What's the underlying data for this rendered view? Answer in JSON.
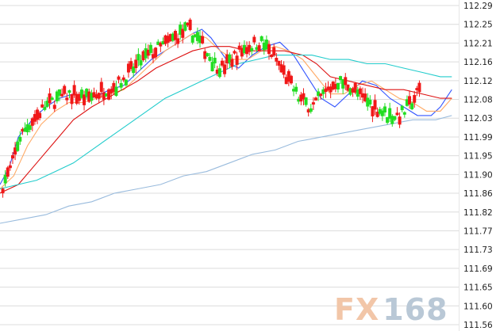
{
  "watermark": {
    "prefix": "FX",
    "suffix": "168"
  },
  "colors": {
    "up": "#f01818",
    "down": "#22dd22",
    "grid": "#dcdcdc",
    "ma_blue": "#3355ff",
    "ma_orange": "#ffaa66",
    "ma_red": "#dd1111",
    "ma_cyan": "#22cccc",
    "ma_lightblue": "#99bbdd",
    "wm_fx": "#f2c6a8",
    "wm_168": "#b9c8d6"
  },
  "chart_data": {
    "type": "candlestick",
    "title": "",
    "xlabel": "",
    "ylabel": "",
    "ylim": [
      111.555,
      112.295
    ],
    "y_ticks": [
      "112.29",
      "112.25",
      "112.21",
      "112.16",
      "112.12",
      "112.08",
      "112.03",
      "111.99",
      "111.95",
      "111.90",
      "111.86",
      "111.82",
      "111.77",
      "111.73",
      "111.69",
      "111.65",
      "111.60",
      "111.56"
    ],
    "grid": true,
    "y_axis_position": "right",
    "moving_averages": [
      {
        "color_key": "ma_blue",
        "points": [
          [
            0,
            111.88
          ],
          [
            0.02,
            111.92
          ],
          [
            0.04,
            111.99
          ],
          [
            0.07,
            112.03
          ],
          [
            0.1,
            112.06
          ],
          [
            0.13,
            112.08
          ],
          [
            0.16,
            112.09
          ],
          [
            0.2,
            112.08
          ],
          [
            0.24,
            112.1
          ],
          [
            0.27,
            112.11
          ],
          [
            0.3,
            112.14
          ],
          [
            0.33,
            112.17
          ],
          [
            0.36,
            112.19
          ],
          [
            0.39,
            112.21
          ],
          [
            0.42,
            112.23
          ],
          [
            0.44,
            112.24
          ],
          [
            0.46,
            112.22
          ],
          [
            0.48,
            112.19
          ],
          [
            0.5,
            112.16
          ],
          [
            0.52,
            112.15
          ],
          [
            0.55,
            112.18
          ],
          [
            0.58,
            112.2
          ],
          [
            0.61,
            112.21
          ],
          [
            0.64,
            112.18
          ],
          [
            0.67,
            112.13
          ],
          [
            0.7,
            112.08
          ],
          [
            0.73,
            112.06
          ],
          [
            0.76,
            112.09
          ],
          [
            0.79,
            112.12
          ],
          [
            0.82,
            112.11
          ],
          [
            0.85,
            112.08
          ],
          [
            0.88,
            112.06
          ],
          [
            0.91,
            112.04
          ],
          [
            0.94,
            112.04
          ],
          [
            0.96,
            112.06
          ],
          [
            0.985,
            112.1
          ]
        ]
      },
      {
        "color_key": "ma_orange",
        "points": [
          [
            0,
            111.87
          ],
          [
            0.03,
            111.9
          ],
          [
            0.06,
            111.97
          ],
          [
            0.09,
            112.02
          ],
          [
            0.12,
            112.05
          ],
          [
            0.15,
            112.07
          ],
          [
            0.18,
            112.07
          ],
          [
            0.21,
            112.08
          ],
          [
            0.24,
            112.09
          ],
          [
            0.27,
            112.1
          ],
          [
            0.3,
            112.13
          ],
          [
            0.33,
            112.16
          ],
          [
            0.36,
            112.19
          ],
          [
            0.39,
            112.21
          ],
          [
            0.42,
            112.23
          ],
          [
            0.45,
            112.22
          ],
          [
            0.48,
            112.19
          ],
          [
            0.51,
            112.17
          ],
          [
            0.54,
            112.17
          ],
          [
            0.57,
            112.19
          ],
          [
            0.6,
            112.2
          ],
          [
            0.63,
            112.19
          ],
          [
            0.66,
            112.17
          ],
          [
            0.69,
            112.13
          ],
          [
            0.72,
            112.09
          ],
          [
            0.75,
            112.09
          ],
          [
            0.78,
            112.11
          ],
          [
            0.81,
            112.12
          ],
          [
            0.84,
            112.1
          ],
          [
            0.87,
            112.08
          ],
          [
            0.9,
            112.07
          ],
          [
            0.93,
            112.05
          ],
          [
            0.96,
            112.05
          ],
          [
            0.985,
            112.08
          ]
        ]
      },
      {
        "color_key": "ma_red",
        "points": [
          [
            0,
            111.86
          ],
          [
            0.04,
            111.88
          ],
          [
            0.08,
            111.93
          ],
          [
            0.12,
            111.98
          ],
          [
            0.16,
            112.03
          ],
          [
            0.2,
            112.06
          ],
          [
            0.25,
            112.09
          ],
          [
            0.3,
            112.12
          ],
          [
            0.34,
            112.15
          ],
          [
            0.38,
            112.17
          ],
          [
            0.42,
            112.19
          ],
          [
            0.46,
            112.2
          ],
          [
            0.5,
            112.2
          ],
          [
            0.54,
            112.19
          ],
          [
            0.58,
            112.19
          ],
          [
            0.62,
            112.19
          ],
          [
            0.66,
            112.18
          ],
          [
            0.69,
            112.16
          ],
          [
            0.72,
            112.13
          ],
          [
            0.76,
            112.12
          ],
          [
            0.8,
            112.11
          ],
          [
            0.84,
            112.1
          ],
          [
            0.88,
            112.1
          ],
          [
            0.92,
            112.09
          ],
          [
            0.96,
            112.08
          ],
          [
            0.985,
            112.08
          ]
        ]
      },
      {
        "color_key": "ma_cyan",
        "points": [
          [
            0,
            111.87
          ],
          [
            0.04,
            111.88
          ],
          [
            0.08,
            111.89
          ],
          [
            0.12,
            111.91
          ],
          [
            0.16,
            111.93
          ],
          [
            0.2,
            111.96
          ],
          [
            0.24,
            111.99
          ],
          [
            0.28,
            112.02
          ],
          [
            0.32,
            112.05
          ],
          [
            0.36,
            112.08
          ],
          [
            0.4,
            112.1
          ],
          [
            0.44,
            112.12
          ],
          [
            0.48,
            112.14
          ],
          [
            0.52,
            112.16
          ],
          [
            0.56,
            112.17
          ],
          [
            0.6,
            112.18
          ],
          [
            0.64,
            112.18
          ],
          [
            0.68,
            112.18
          ],
          [
            0.72,
            112.17
          ],
          [
            0.76,
            112.17
          ],
          [
            0.8,
            112.16
          ],
          [
            0.84,
            112.16
          ],
          [
            0.88,
            112.15
          ],
          [
            0.92,
            112.14
          ],
          [
            0.96,
            112.13
          ],
          [
            0.985,
            112.13
          ]
        ]
      },
      {
        "color_key": "ma_lightblue",
        "points": [
          [
            0,
            111.79
          ],
          [
            0.05,
            111.8
          ],
          [
            0.1,
            111.81
          ],
          [
            0.15,
            111.83
          ],
          [
            0.2,
            111.84
          ],
          [
            0.25,
            111.86
          ],
          [
            0.3,
            111.87
          ],
          [
            0.35,
            111.88
          ],
          [
            0.4,
            111.9
          ],
          [
            0.45,
            111.91
          ],
          [
            0.5,
            111.93
          ],
          [
            0.55,
            111.95
          ],
          [
            0.6,
            111.96
          ],
          [
            0.65,
            111.98
          ],
          [
            0.7,
            111.99
          ],
          [
            0.75,
            112.0
          ],
          [
            0.8,
            112.01
          ],
          [
            0.85,
            112.02
          ],
          [
            0.9,
            112.03
          ],
          [
            0.95,
            112.03
          ],
          [
            0.985,
            112.04
          ]
        ]
      }
    ]
  }
}
